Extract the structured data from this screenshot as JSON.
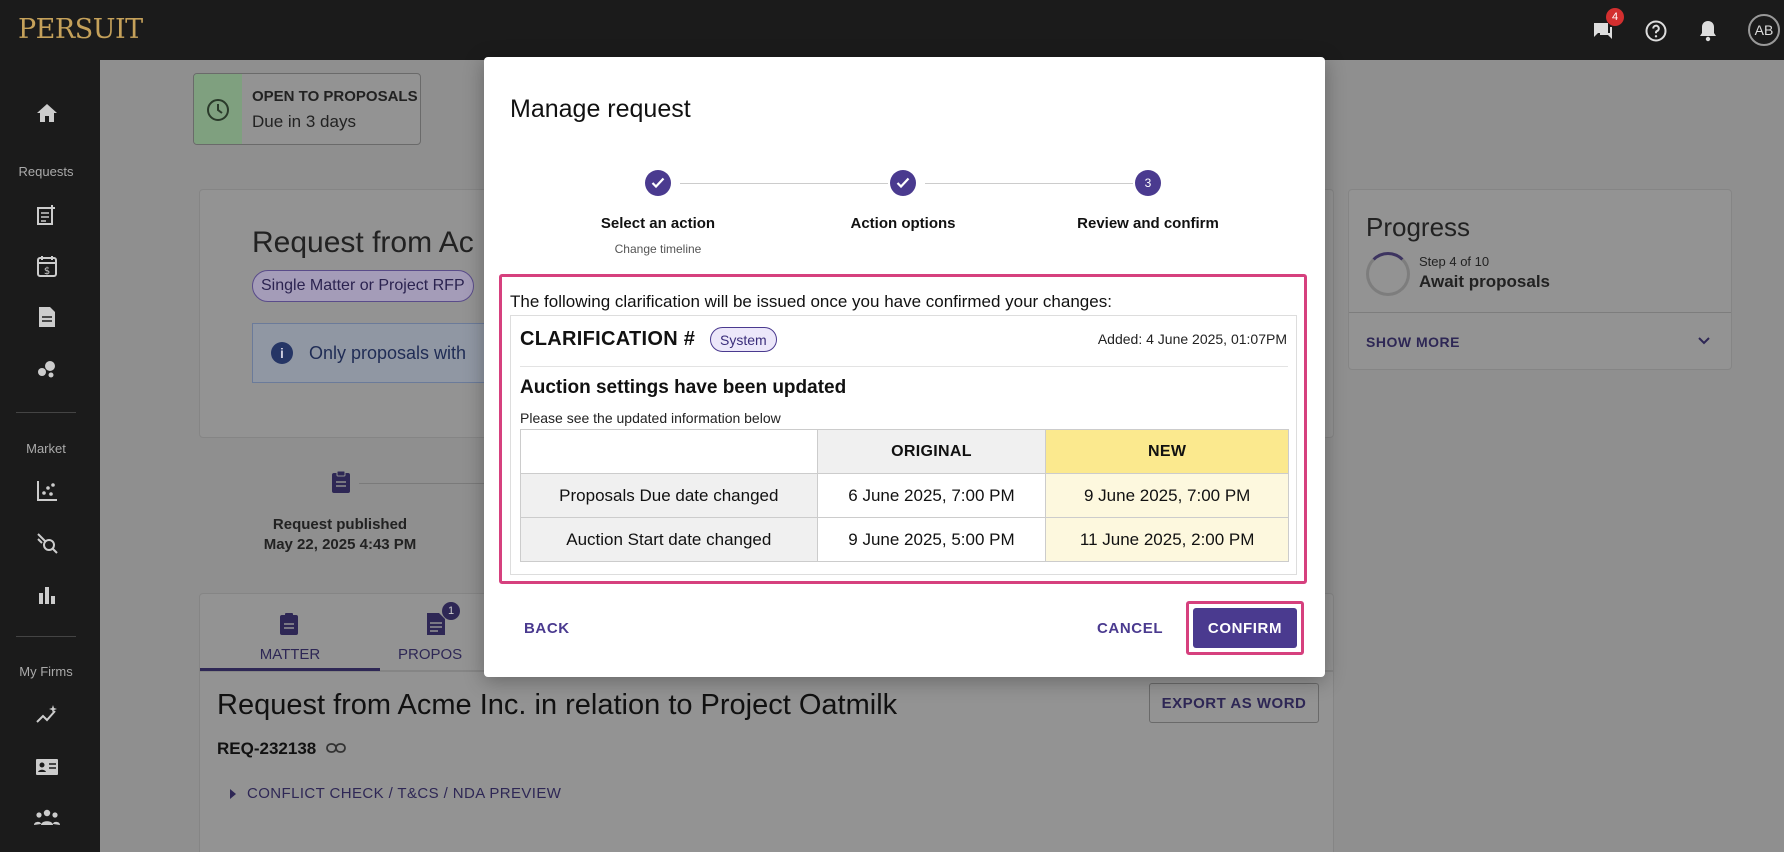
{
  "app": {
    "logo": "PERSUIT"
  },
  "topbar": {
    "messages_badge": "4",
    "avatar_initials": "AB"
  },
  "sidebar": {
    "sections": {
      "requests": "Requests",
      "market": "Market",
      "my_firms": "My Firms"
    }
  },
  "background": {
    "status": {
      "title": "OPEN TO PROPOSALS",
      "due": "Due in 3 days"
    },
    "request_header": {
      "title_partial": "Request from Ac",
      "tag": "Single Matter or Project RFP",
      "info_partial": "Only proposals with"
    },
    "progress": {
      "title": "Progress",
      "step": "Step 4 of 10",
      "stage": "Await proposals",
      "show_more": "SHOW MORE"
    },
    "timeline": {
      "label": "Request published",
      "date": "May 22, 2025 4:43 PM"
    },
    "tabs": {
      "matter": "MATTER",
      "proposals_partial": "PROPOS",
      "proposals_badge": "1"
    },
    "matter": {
      "title": "Request from Acme Inc. in relation to Project Oatmilk",
      "ref": "REQ-232138",
      "export_button": "EXPORT AS WORD",
      "conflict_link": "CONFLICT CHECK / T&CS / NDA PREVIEW"
    }
  },
  "modal": {
    "title": "Manage request",
    "steps": [
      {
        "label": "Select an action",
        "sub": "Change timeline",
        "state": "done"
      },
      {
        "label": "Action options",
        "sub": "",
        "state": "done"
      },
      {
        "label": "Review and confirm",
        "sub": "",
        "state": "active",
        "number": "3"
      }
    ],
    "intro": "The following clarification will be issued once you have confirmed your changes:",
    "clarification": {
      "title": "CLARIFICATION #",
      "badge": "System",
      "added": "Added: 4 June 2025, 01:07PM",
      "heading": "Auction settings have been updated",
      "subheading": "Please see the updated information below",
      "columns": {
        "original": "ORIGINAL",
        "new": "NEW"
      },
      "rows": [
        {
          "label": "Proposals Due date changed",
          "original": "6 June 2025, 7:00 PM",
          "new": "9 June 2025, 7:00 PM"
        },
        {
          "label": "Auction Start date changed",
          "original": "9 June 2025, 5:00 PM",
          "new": "11 June 2025, 2:00 PM"
        }
      ]
    },
    "buttons": {
      "back": "BACK",
      "cancel": "CANCEL",
      "confirm": "CONFIRM"
    }
  },
  "colors": {
    "accent": "#4a3a8f",
    "highlight": "#d6407e",
    "new_header": "#fbe98e"
  }
}
